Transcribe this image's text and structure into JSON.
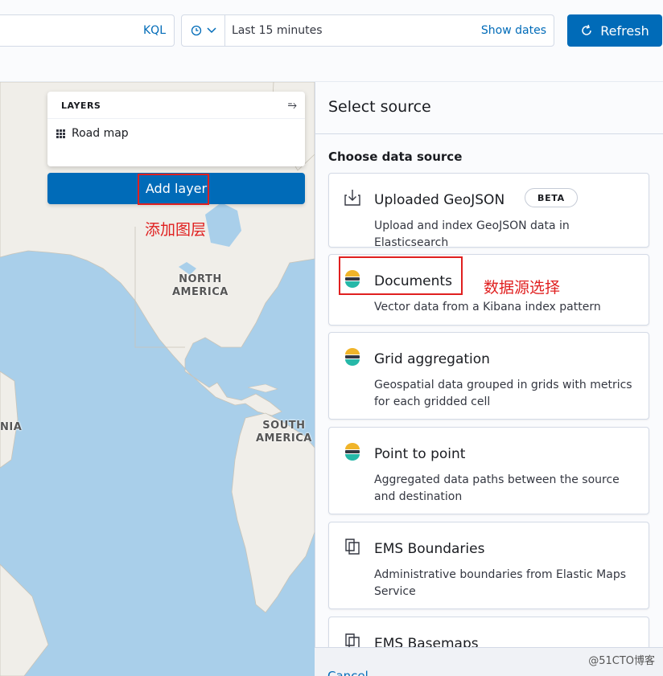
{
  "topbar": {
    "query_language": "KQL",
    "time_range": "Last 15 minutes",
    "show_dates": "Show dates",
    "refresh": "Refresh"
  },
  "map": {
    "labels": {
      "north_america": "NORTH\nAMERICA",
      "south_america": "SOUTH\nAMERICA",
      "partial": "NIA"
    },
    "layers_panel": {
      "title": "LAYERS",
      "items": [
        {
          "label": "Road map"
        }
      ]
    },
    "add_layer": "Add layer"
  },
  "annotations": {
    "add_layer_note": "添加图层",
    "source_note": "数据源选择"
  },
  "flyout": {
    "title": "Select source",
    "section_title": "Choose data source",
    "sources": [
      {
        "title": "Uploaded GeoJSON",
        "badge": "BETA",
        "description": "Upload and index GeoJSON data in Elasticsearch",
        "icon": "upload-icon"
      },
      {
        "title": "Documents",
        "description": "Vector data from a Kibana index pattern",
        "icon": "elastic-logo-icon"
      },
      {
        "title": "Grid aggregation",
        "description": "Geospatial data grouped in grids with metrics for each gridded cell",
        "icon": "elastic-logo-icon"
      },
      {
        "title": "Point to point",
        "description": "Aggregated data paths between the source and destination",
        "icon": "elastic-logo-icon"
      },
      {
        "title": "EMS Boundaries",
        "description": "Administrative boundaries from Elastic Maps Service",
        "icon": "ems-icon"
      },
      {
        "title": "EMS Basemaps",
        "description": "",
        "icon": "ems-icon"
      }
    ],
    "cancel": "Cancel"
  },
  "watermark": "@51CTO博客"
}
